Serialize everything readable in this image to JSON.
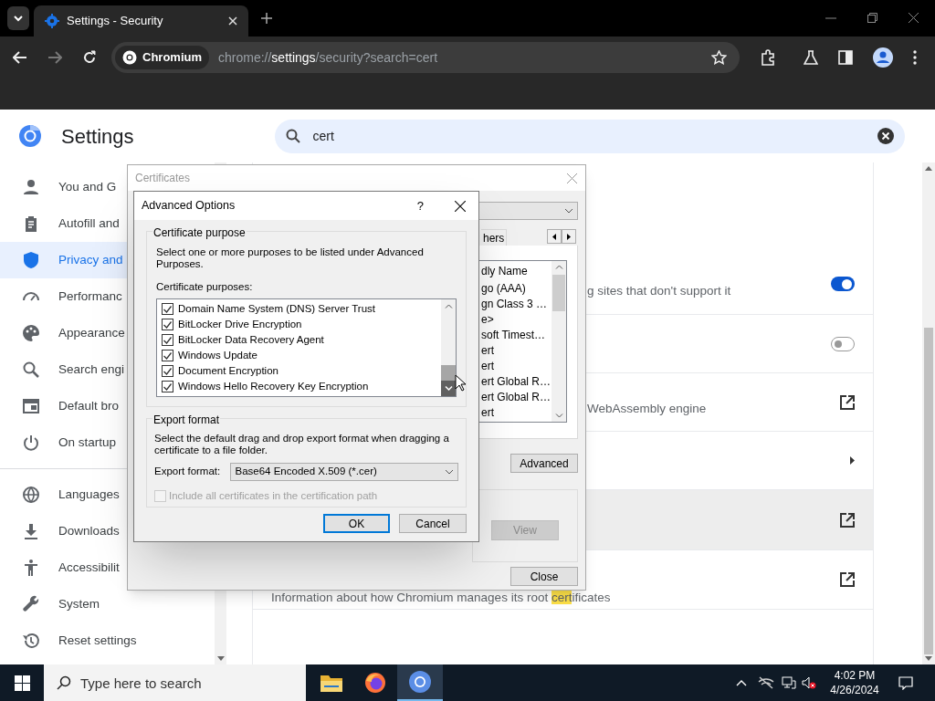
{
  "browser": {
    "tab_title": "Settings - Security",
    "origin_chip": "Chromium",
    "url_scheme": "chrome://",
    "url_host": "settings",
    "url_path": "/security?search=cert"
  },
  "settings": {
    "title": "Settings",
    "search_value": "cert"
  },
  "sidebar": {
    "items_top": [
      {
        "label": "You and G",
        "selected": false
      },
      {
        "label": "Autofill and",
        "selected": false
      },
      {
        "label": "Privacy and",
        "selected": true
      },
      {
        "label": "Performanc",
        "selected": false
      },
      {
        "label": "Appearance",
        "selected": false
      },
      {
        "label": "Search engi",
        "selected": false
      },
      {
        "label": "Default bro",
        "selected": false
      },
      {
        "label": "On startup",
        "selected": false
      }
    ],
    "items_bottom": [
      {
        "label": "Languages",
        "selected": false
      },
      {
        "label": "Downloads",
        "selected": false
      },
      {
        "label": "Accessibilit",
        "selected": false
      },
      {
        "label": "System",
        "selected": false
      },
      {
        "label": "Reset settings",
        "selected": false
      }
    ]
  },
  "rows": [
    {
      "kind": "toggle",
      "text": "g sites that don't support it",
      "on": true,
      "hovered": false
    },
    {
      "kind": "toggle",
      "on": false,
      "hovered": false
    },
    {
      "kind": "external",
      "text": "WebAssembly engine",
      "hovered": false
    },
    {
      "kind": "submenu",
      "hovered": false
    },
    {
      "kind": "external",
      "hovered": true
    },
    {
      "kind": "external",
      "text": "Information about how Chromium manages its root ",
      "match": "cert",
      "text_after": "ificates",
      "hovered": false
    }
  ],
  "certificates_dialog": {
    "title": "Certificates",
    "tab_fragment": "hers",
    "list_header": "dly Name",
    "list_rows": [
      "go (AAA)",
      "gn Class 3 …",
      "e>",
      "soft Timest…",
      "ert",
      "ert",
      "ert Global R…",
      "ert Global R…",
      "ert"
    ],
    "advanced_button": "Advanced",
    "view_button": {
      "label": "View",
      "disabled": true
    },
    "close_button": "Close"
  },
  "advanced_options": {
    "title": "Advanced Options",
    "help": "?",
    "purpose_group": "Certificate purpose",
    "purpose_help": "Select one or more purposes to be listed under Advanced Purposes.",
    "purposes_label": "Certificate purposes:",
    "purposes": [
      {
        "label": "Domain Name System (DNS) Server Trust",
        "checked": true
      },
      {
        "label": "BitLocker Drive Encryption",
        "checked": true
      },
      {
        "label": "BitLocker Data Recovery Agent",
        "checked": true
      },
      {
        "label": "Windows Update",
        "checked": true
      },
      {
        "label": "Document Encryption",
        "checked": true
      },
      {
        "label": "Windows Hello Recovery Key Encryption",
        "checked": true
      }
    ],
    "export_group": "Export format",
    "export_help": "Select the default drag and drop export format when dragging a certificate to a file folder.",
    "export_label": "Export format:",
    "export_value": "Base64 Encoded X.509 (*.cer)",
    "include_path": {
      "label": "Include all certificates in the certification path",
      "checked": false,
      "disabled": true
    },
    "ok_button": "OK",
    "cancel_button": "Cancel"
  },
  "taskbar": {
    "search_placeholder": "Type here to search",
    "time": "4:02 PM",
    "date": "4/26/2024"
  }
}
